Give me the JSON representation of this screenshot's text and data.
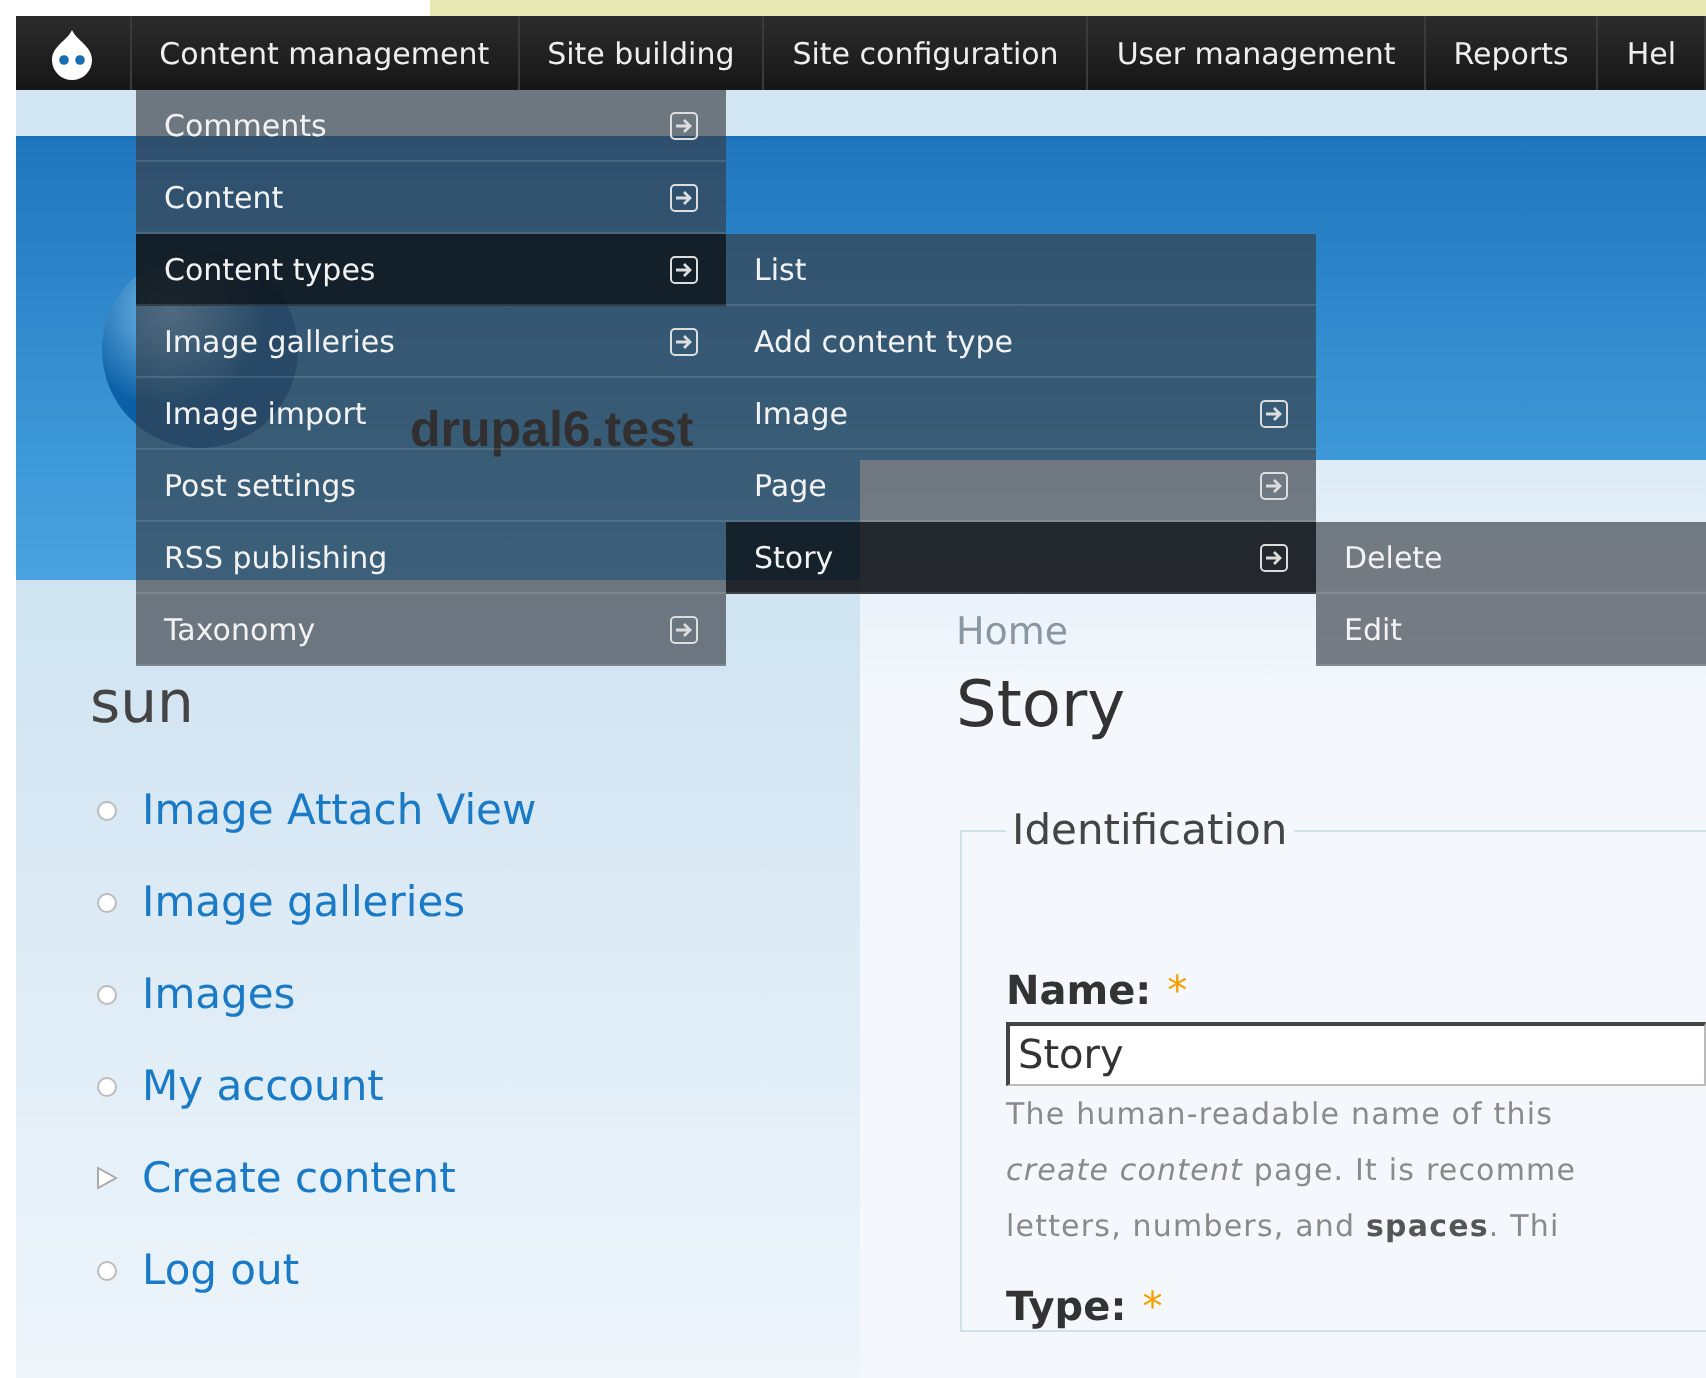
{
  "admin_menu": {
    "items": [
      {
        "label": "Content management"
      },
      {
        "label": "Site building"
      },
      {
        "label": "Site configuration"
      },
      {
        "label": "User management"
      },
      {
        "label": "Reports"
      },
      {
        "label": "Hel"
      }
    ]
  },
  "dropdown": {
    "items": [
      {
        "label": "Comments",
        "has_submenu": true,
        "selected": false
      },
      {
        "label": "Content",
        "has_submenu": true,
        "selected": false
      },
      {
        "label": "Content types",
        "has_submenu": true,
        "selected": true,
        "children": [
          {
            "label": "List",
            "has_submenu": false,
            "selected": false
          },
          {
            "label": "Add content type",
            "has_submenu": false,
            "selected": false
          },
          {
            "label": "Image",
            "has_submenu": true,
            "selected": false
          },
          {
            "label": "Page",
            "has_submenu": true,
            "selected": false
          },
          {
            "label": "Story",
            "has_submenu": true,
            "selected": true,
            "children": [
              {
                "label": "Delete",
                "has_submenu": false,
                "selected": false
              },
              {
                "label": "Edit",
                "has_submenu": false,
                "selected": false
              }
            ]
          }
        ]
      },
      {
        "label": "Image galleries",
        "has_submenu": true,
        "selected": false
      },
      {
        "label": "Image import",
        "has_submenu": false,
        "selected": false
      },
      {
        "label": "Post settings",
        "has_submenu": false,
        "selected": false
      },
      {
        "label": "RSS publishing",
        "has_submenu": false,
        "selected": false
      },
      {
        "label": "Taxonomy",
        "has_submenu": true,
        "selected": false
      }
    ]
  },
  "header": {
    "site_name": "drupal6.test"
  },
  "breadcrumb": "Home",
  "sidebar": {
    "title": "sun",
    "links": [
      {
        "label": "Image Attach View",
        "kind": "leaf"
      },
      {
        "label": "Image galleries",
        "kind": "leaf"
      },
      {
        "label": "Images",
        "kind": "leaf"
      },
      {
        "label": "My account",
        "kind": "leaf"
      },
      {
        "label": "Create content",
        "kind": "collapsed"
      },
      {
        "label": "Log out",
        "kind": "leaf"
      }
    ]
  },
  "content": {
    "title": "Story",
    "fieldset": {
      "legend": "Identification",
      "fields": [
        {
          "label": "Name:",
          "required_mark": "*",
          "value": "Story",
          "description_lines": [
            "The human-readable name of this",
            "*create content* page. It is recomme",
            "letters, numbers, and **spaces**. Thi"
          ]
        },
        {
          "label": "Type:",
          "required_mark": "*"
        }
      ]
    }
  }
}
